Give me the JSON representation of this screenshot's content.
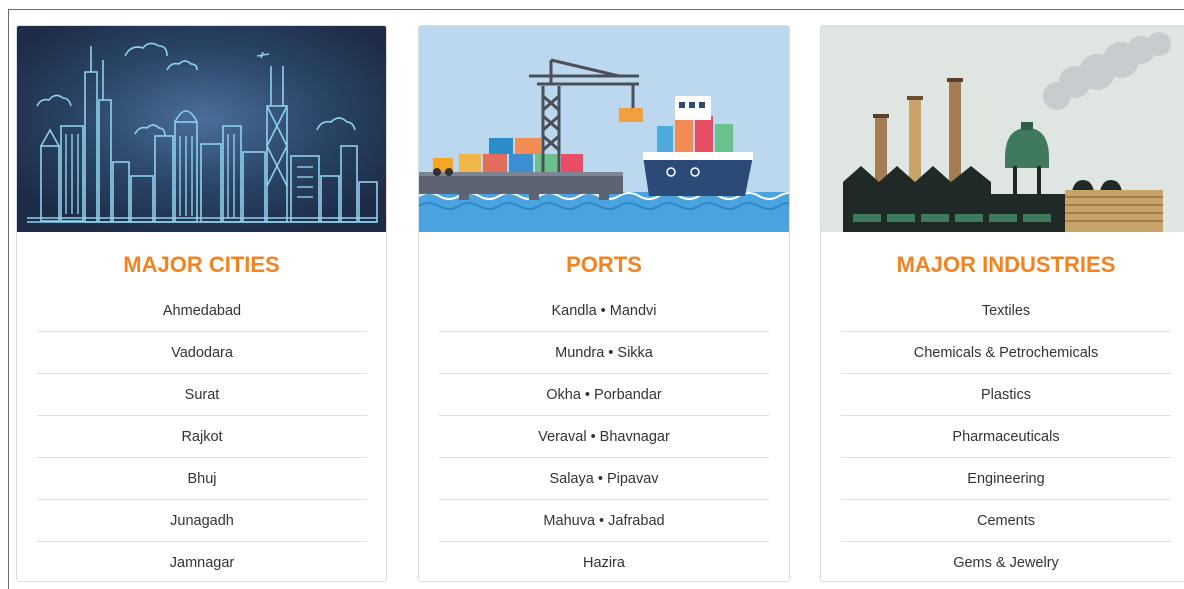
{
  "cards": [
    {
      "id": "cities",
      "title": "MAJOR CITIES",
      "items": [
        "Ahmedabad",
        "Vadodara",
        "Surat",
        "Rajkot",
        "Bhuj",
        "Junagadh",
        "Jamnagar"
      ]
    },
    {
      "id": "ports",
      "title": "PORTS",
      "items": [
        "Kandla • Mandvi",
        "Mundra • Sikka",
        "Okha • Porbandar",
        "Veraval • Bhavnagar",
        "Salaya • Pipavav",
        "Mahuva • Jafrabad",
        "Hazira"
      ]
    },
    {
      "id": "industries",
      "title": "MAJOR INDUSTRIES",
      "items": [
        "Textiles",
        "Chemicals & Petrochemicals",
        "Plastics",
        "Pharmaceuticals",
        "Engineering",
        "Cements",
        "Gems & Jewelry"
      ]
    }
  ],
  "colors": {
    "title": "#f5821f",
    "text": "#333333",
    "divider": "#e0e0e0",
    "city_bg": "#1f3550",
    "port_sky": "#bcd8ef",
    "industry_bg": "#dfe6e2"
  },
  "icons": [
    "city-skyline-illustration",
    "port-crane-ship-illustration",
    "factory-smokestacks-illustration"
  ]
}
